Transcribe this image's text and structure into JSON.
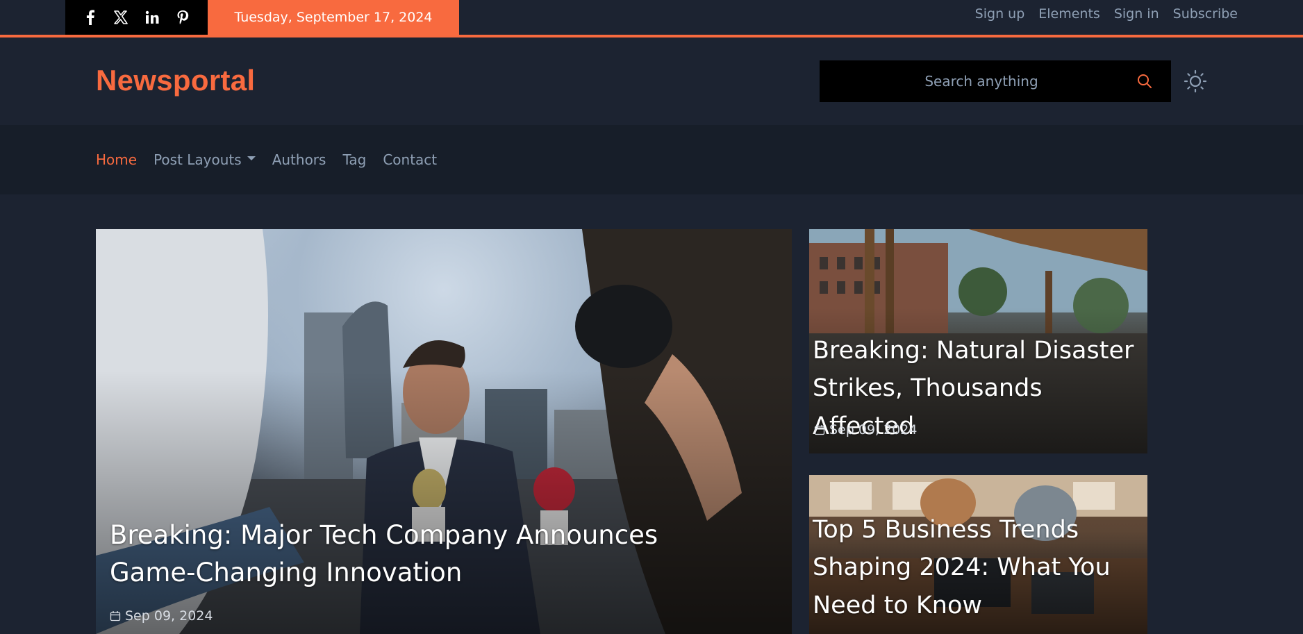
{
  "topbar": {
    "social": [
      {
        "name": "facebook-icon"
      },
      {
        "name": "x-twitter-icon"
      },
      {
        "name": "linkedin-icon"
      },
      {
        "name": "pinterest-icon"
      }
    ],
    "date": "Tuesday, September 17, 2024",
    "links": [
      "Sign up",
      "Elements",
      "Sign in",
      "Subscribe"
    ]
  },
  "header": {
    "logo": "Newsportal",
    "search_placeholder": "Search anything",
    "theme_icon": "sun-icon"
  },
  "nav": {
    "items": [
      "Home",
      "Post Layouts",
      "Authors",
      "Tag",
      "Contact"
    ],
    "active": "Home"
  },
  "featured": {
    "main": {
      "title": "Breaking: Major Tech Company Announces Game-Changing Innovation",
      "date": "Sep 09, 2024"
    },
    "side": [
      {
        "title": "Breaking: Natural Disaster Strikes, Thousands Affected",
        "date": "Sep 09, 2024"
      },
      {
        "title": "Top 5 Business Trends Shaping 2024: What You Need to Know"
      }
    ]
  },
  "colors": {
    "accent": "#f86a3f",
    "background": "#1c2331",
    "nav_background": "#171e29",
    "muted_text": "#8fa0b5"
  }
}
